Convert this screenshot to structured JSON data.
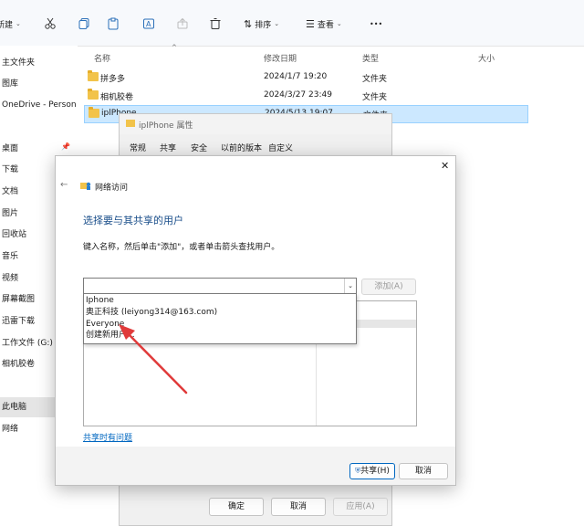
{
  "toolbar": {
    "new_label": "新建",
    "sort_label": "排序",
    "view_label": "查看",
    "more_label": "•••"
  },
  "sidebar": {
    "items": [
      "主文件夹",
      "图库",
      "OneDrive - Person",
      "桌面",
      "下载",
      "文档",
      "图片",
      "回收站",
      "音乐",
      "视频",
      "屏幕截图",
      "迅雷下载",
      "工作文件 (G:)",
      "相机胶卷",
      "此电脑",
      "网络"
    ]
  },
  "columns": {
    "name": "名称",
    "date": "修改日期",
    "type": "类型",
    "size": "大小"
  },
  "files": [
    {
      "name": "拼多多",
      "date": "2024/1/7 19:20",
      "type": "文件夹"
    },
    {
      "name": "相机胶卷",
      "date": "2024/3/27 23:49",
      "type": "文件夹"
    },
    {
      "name": "iplPhone",
      "date": "2024/5/13 19:07",
      "type": "文件夹"
    }
  ],
  "properties": {
    "title": "iplPhone 属性",
    "tabs": [
      "常规",
      "共享",
      "安全",
      "以前的版本",
      "自定义"
    ],
    "ok_label": "确定",
    "cancel_label": "取消",
    "apply_label": "应用(A)"
  },
  "dialog": {
    "title": "网络访问",
    "heading": "选择要与其共享的用户",
    "instruction": "键入名称，然后单击\"添加\"，或者单击箭头查找用户。",
    "add_label": "添加(A)",
    "dropdown_options": [
      "Iphone",
      "奥正科技 (leiyong314@163.com)",
      "Everyone",
      "创建新用户..."
    ],
    "help_link": "共享时有问题",
    "share_label": "共享(H)",
    "cancel_label": "取消"
  },
  "colors": {
    "accent": "#0067c0",
    "selection": "#cce8ff",
    "arrow": "#e03a3a",
    "heading": "#1a4e8a"
  }
}
